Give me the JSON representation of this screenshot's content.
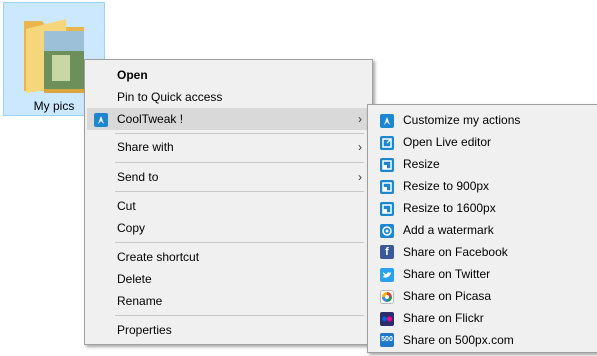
{
  "folder": {
    "label": "My pics"
  },
  "main_menu": {
    "open": "Open",
    "pin": "Pin to Quick access",
    "cooltweak": "CoolTweak !",
    "share_with": "Share with",
    "send_to": "Send to",
    "cut": "Cut",
    "copy": "Copy",
    "create_shortcut": "Create shortcut",
    "delete": "Delete",
    "rename": "Rename",
    "properties": "Properties",
    "arrow": "›"
  },
  "sub_menu": {
    "items": [
      {
        "label": "Customize my actions",
        "icon": "cooltweak-icon"
      },
      {
        "label": "Open Live editor",
        "icon": "live-editor-icon"
      },
      {
        "label": "Resize",
        "icon": "resize-icon"
      },
      {
        "label": "Resize to 900px",
        "icon": "resize-icon"
      },
      {
        "label": "Resize to 1600px",
        "icon": "resize-icon"
      },
      {
        "label": "Add a watermark",
        "icon": "watermark-icon"
      },
      {
        "label": "Share on Facebook",
        "icon": "facebook-icon"
      },
      {
        "label": "Share on Twitter",
        "icon": "twitter-icon"
      },
      {
        "label": "Share on Picasa",
        "icon": "picasa-icon"
      },
      {
        "label": "Share on Flickr",
        "icon": "flickr-icon"
      },
      {
        "label": "Share on 500px.com",
        "icon": "500px-icon"
      }
    ],
    "fb_glyph": "f",
    "px_glyph": "500"
  }
}
